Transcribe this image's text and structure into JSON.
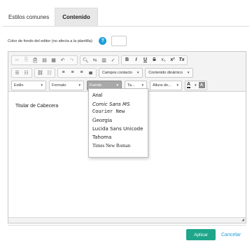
{
  "tabs": [
    {
      "label": "Estilos comunes",
      "active": false
    },
    {
      "label": "Contenido",
      "active": true
    }
  ],
  "color_setting": {
    "label": "Color de fondo del editor (no afecta a la plantilla):",
    "help_glyph": "?",
    "help_color": "#1a9fd9"
  },
  "toolbar": {
    "row1_icons": [
      "cut-icon",
      "copy-icon",
      "paste-icon",
      "paste-text-icon",
      "paste-word-icon",
      "undo-icon",
      "redo-icon",
      "find-icon",
      "replace-icon",
      "select-all-icon",
      "spellcheck-icon"
    ],
    "format": {
      "bold": "B",
      "italic": "I",
      "underline": "U",
      "strike": "S",
      "subscript": "x₂",
      "superscript": "x²",
      "remove_format": "Tx"
    },
    "campos_contacto": "Campos contacto",
    "contenido_dinamico": "Contenido dinámico",
    "style_combo": "Estilo",
    "format_combo": "Formato",
    "font_combo": "Fuente",
    "size_combo": "Ta...",
    "height_combo": "Altura de...",
    "text_color_glyph": "A",
    "bg_color_glyph": "A"
  },
  "content": {
    "text": "Titular de Cabecera"
  },
  "font_dropdown": [
    {
      "label": "Arial",
      "family": "\"Liberation Sans\", sans-serif",
      "style": "normal"
    },
    {
      "label": "Comic Sans MS",
      "family": "\"DejaVu Sans\", sans-serif",
      "style": "italic"
    },
    {
      "label": "Courier New",
      "family": "\"Liberation Mono\", monospace",
      "style": "normal"
    },
    {
      "label": "Georgia",
      "family": "\"DejaVu Serif\", serif",
      "style": "normal"
    },
    {
      "label": "Lucida Sans Unicode",
      "family": "\"DejaVu Sans\", sans-serif",
      "style": "normal"
    },
    {
      "label": "Tahoma",
      "family": "\"DejaVu Sans\", sans-serif",
      "style": "normal"
    },
    {
      "label": "Times New Roman",
      "family": "\"Liberation Serif\", serif",
      "style": "normal"
    }
  ],
  "footer": {
    "apply_label": "Aplicar",
    "cancel_label": "Cancelar",
    "apply_color": "#1fa68a",
    "cancel_color": "#1a9fd9"
  }
}
